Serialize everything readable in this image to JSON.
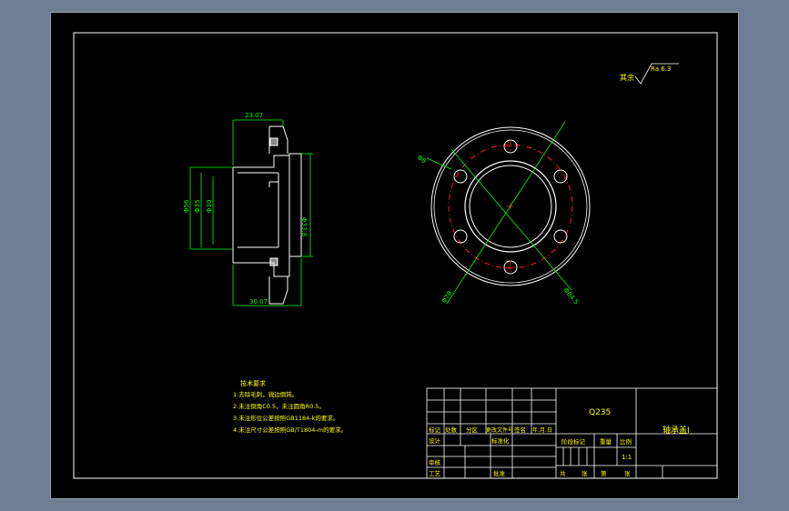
{
  "drawing": {
    "roughness_label": "其余",
    "roughness_value": "Ra 6.3",
    "dims": {
      "top_width": "23.07",
      "bottom_width": "30.07",
      "dia_outer_left": "Φ56",
      "dia_2": "Φ35",
      "dia_3": "Φ30",
      "dia_right": "Φ33.8",
      "hole_dia": "Φ8",
      "pcd": "Φ78",
      "flange_dia": "Φ84.5"
    },
    "notes": {
      "title": "技术要求",
      "items": [
        "1.去除毛刺，锐边倒钝。",
        "2.未注倒角C0.5，未注圆角R0.5。",
        "3.未注形位公差按照GB1184-k的要求。",
        "4.未注尺寸公差按照GB/T1804-m的要求。"
      ]
    },
    "title_block": {
      "material": "Q235",
      "part_name": "轴承盖I",
      "scale": "1:1",
      "h_mark": "标记",
      "h_count": "处数",
      "h_zone": "分区",
      "h_doc": "更改文件号",
      "h_sign": "签名",
      "h_date": "年.月.日",
      "designer": "设计",
      "standard": "标准化",
      "stage": "阶段标记",
      "weight": "重量",
      "ratio": "比例",
      "review": "审核",
      "process": "工艺",
      "approve": "批准",
      "total": "共",
      "sheets": "张",
      "sheet_no": "第",
      "sheet_unit": "张"
    }
  }
}
